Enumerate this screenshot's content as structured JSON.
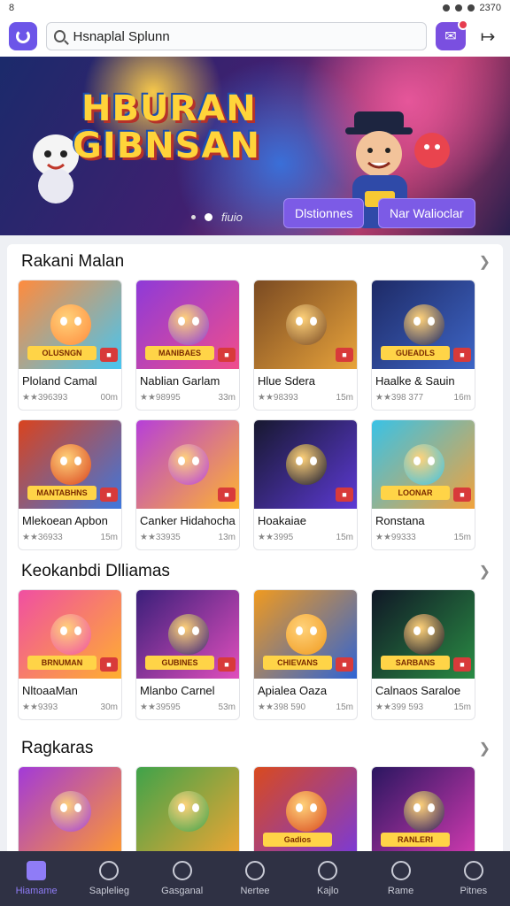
{
  "status_bar": {
    "left": "8",
    "right": "2370"
  },
  "search": {
    "value": "Hsnaplal Splunn"
  },
  "hero": {
    "title_line1": "HBURAN",
    "title_line2": "GIBNSAN",
    "page_label": "fiuio",
    "button_primary": "Dlstionnes",
    "button_secondary": "Nar Walioclar"
  },
  "sections": [
    {
      "title": "Rakani Malan",
      "rows": [
        [
          {
            "name": "Ploland Camal",
            "rating": "★★396393",
            "size": "00m",
            "tag": "OLUSNGN",
            "colors": [
              "#ff8b3d",
              "#44c6f3"
            ]
          },
          {
            "name": "Nablian Garlam",
            "rating": "★★98995",
            "size": "33m",
            "tag": "MANIBAES",
            "colors": [
              "#8e3ad8",
              "#f14e8b"
            ]
          },
          {
            "name": "Hlue Sdera",
            "rating": "★★98393",
            "size": "15m",
            "tag": "",
            "colors": [
              "#7a4a22",
              "#e9a43b"
            ]
          },
          {
            "name": "Haalke & Sauin",
            "rating": "★★398 377",
            "size": "16m",
            "tag": "GUEADLS",
            "colors": [
              "#1e2a66",
              "#3e66c7"
            ]
          }
        ],
        [
          {
            "name": "Mlekoean Apbon",
            "rating": "★★36933",
            "size": "15m",
            "tag": "MANTABHNS",
            "colors": [
              "#d9431e",
              "#3c78e0"
            ]
          },
          {
            "name": "Canker Hidahocha",
            "rating": "★★33935",
            "size": "13m",
            "tag": "",
            "colors": [
              "#b63fd9",
              "#ffb52e"
            ]
          },
          {
            "name": "Hoakaiae",
            "rating": "★★3995",
            "size": "15m",
            "tag": "",
            "colors": [
              "#17182f",
              "#5d3ad6"
            ]
          },
          {
            "name": "Ronstana",
            "rating": "★★99333",
            "size": "15m",
            "tag": "LOONAR",
            "colors": [
              "#39c2e6",
              "#f3a23b"
            ]
          }
        ]
      ]
    },
    {
      "title": "Keokanbdi Dlliamas",
      "rows": [
        [
          {
            "name": "NltoaaMan",
            "rating": "★★9393",
            "size": "30m",
            "tag": "BRNUMAN",
            "colors": [
              "#f04fa2",
              "#ffb02e"
            ]
          },
          {
            "name": "Mlanbo Carnel",
            "rating": "★★39595",
            "size": "53m",
            "tag": "GUBINES",
            "colors": [
              "#3a1f7a",
              "#e24fbd"
            ]
          },
          {
            "name": "Apialea Oaza",
            "rating": "★★398 590",
            "size": "15m",
            "tag": "CHIEVANS",
            "colors": [
              "#f09a1f",
              "#2d63d6"
            ]
          },
          {
            "name": "Calnaos Saraloe",
            "rating": "★★399 593",
            "size": "15m",
            "tag": "SARBANS",
            "colors": [
              "#101726",
              "#2a8d44"
            ]
          }
        ]
      ]
    },
    {
      "title": "Ragkaras",
      "rows": [
        [
          {
            "name": "",
            "rating": "",
            "size": "",
            "tag": "",
            "colors": [
              "#a23ad8",
              "#ff9a2e"
            ]
          },
          {
            "name": "",
            "rating": "",
            "size": "",
            "tag": "",
            "colors": [
              "#3fa34a",
              "#f0a533"
            ]
          },
          {
            "name": "",
            "rating": "",
            "size": "",
            "tag": "Gadios",
            "colors": [
              "#d94a1e",
              "#7a3ad8"
            ]
          },
          {
            "name": "",
            "rating": "",
            "size": "",
            "tag": "RANLERI",
            "colors": [
              "#2a1660",
              "#d13ab0"
            ]
          }
        ]
      ]
    }
  ],
  "bottom_nav": [
    {
      "label": "Hiamame",
      "icon": "home-icon",
      "active": true
    },
    {
      "label": "Saplelieg",
      "icon": "person-icon",
      "active": false
    },
    {
      "label": "Gasganal",
      "icon": "gamepad-icon",
      "active": false
    },
    {
      "label": "Nertee",
      "icon": "search-icon",
      "active": false
    },
    {
      "label": "Kajlo",
      "icon": "globe-icon",
      "active": false
    },
    {
      "label": "Rame",
      "icon": "controller-icon",
      "active": false
    },
    {
      "label": "Pitnes",
      "icon": "magnifier-icon",
      "active": false
    }
  ]
}
